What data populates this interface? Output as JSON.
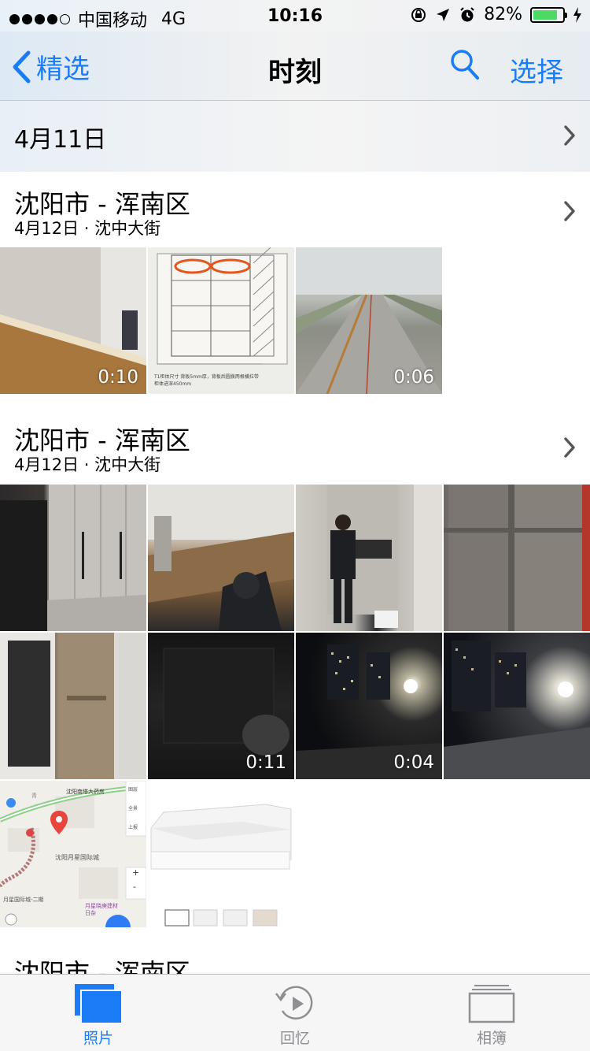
{
  "status_bar": {
    "carrier": "中国移动",
    "network": "4G",
    "time": "10:16",
    "battery_percent": "82%",
    "battery_level": 0.82
  },
  "nav": {
    "back_label": "精选",
    "title": "时刻",
    "select_label": "选择"
  },
  "collapsed_section": {
    "date": "4月11日"
  },
  "moments": [
    {
      "title": "沈阳市 - 浑南区",
      "subtitle": "4月12日 · 沈中大街",
      "thumbs": [
        {
          "duration": "0:10"
        },
        {
          "duration": ""
        },
        {
          "duration": "0:06"
        }
      ]
    },
    {
      "title": "沈阳市 - 浑南区",
      "subtitle": "4月12日 · 沈中大街",
      "thumbs": [
        {
          "duration": ""
        },
        {
          "duration": ""
        },
        {
          "duration": ""
        },
        {
          "duration": ""
        },
        {
          "duration": ""
        },
        {
          "duration": "0:11"
        },
        {
          "duration": "0:04"
        },
        {
          "duration": ""
        },
        {
          "duration": ""
        },
        {
          "duration": ""
        }
      ]
    },
    {
      "title": "沈阳市 - 浑南区"
    }
  ],
  "map_thumb": {
    "poi_top": "沈阳南塔大药房",
    "poi_center": "沈阳月星国际城",
    "poi_bottom_left": "月星国际城-二期",
    "poi_bottom_right": "月星晓庚建材日杂",
    "side_labels": [
      "图层",
      "全景",
      "上报"
    ],
    "zoom_in": "+",
    "zoom_out": "-",
    "road_label": "青"
  },
  "plan_thumb": {
    "caption_line1": "T1柜体尺寸   背板5mm厚，背板后圆拨两根横拉带",
    "caption_line2": "柜体进深450mm"
  },
  "tabs": [
    {
      "label": "照片",
      "icon": "photos-icon",
      "active": true
    },
    {
      "label": "回忆",
      "icon": "memories-icon",
      "active": false
    },
    {
      "label": "相簿",
      "icon": "albums-icon",
      "active": false
    }
  ],
  "colors": {
    "accent": "#1a7cf6",
    "battery_green": "#4cd964",
    "tab_inactive": "#8e8e93",
    "map_pin": "#e8453c"
  }
}
